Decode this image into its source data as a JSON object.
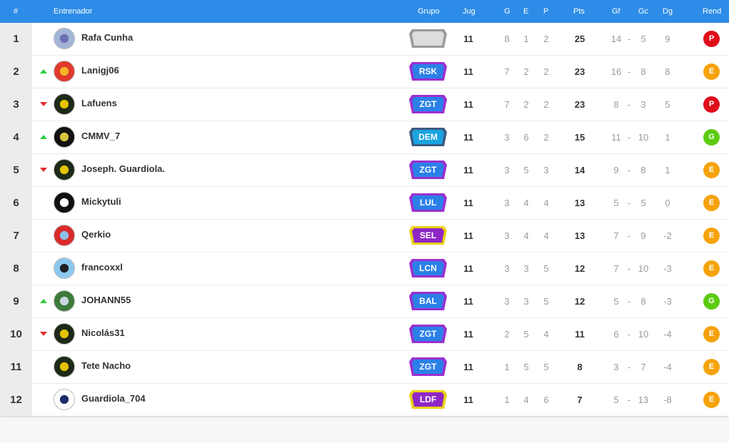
{
  "header": {
    "rank": "#",
    "coach": "Entrenador",
    "group": "Grupo",
    "played": "Jug",
    "won": "G",
    "drawn": "E",
    "lost": "P",
    "points": "Pts",
    "gf": "Gf",
    "gc": "Gc",
    "gd": "Dg",
    "form": "Rend"
  },
  "separator": "-",
  "colors": {
    "header_bg": "#2d8ce7",
    "trend_up": "#2ecc40",
    "trend_down": "#e32d2d",
    "form_P": "#e00d1a",
    "form_E": "#f6a20a",
    "form_G": "#5bcb10"
  },
  "rows": [
    {
      "rank": "1",
      "trend": "none",
      "coach": "Rafa Cunha",
      "group": "",
      "played": "11",
      "won": "8",
      "drawn": "1",
      "lost": "2",
      "points": "25",
      "gf": "14",
      "gc": "5",
      "gd": "9",
      "form": "P",
      "badge_color": "grey",
      "avatar_color": "#a3b5d6",
      "avatar_accent": "#6b6fb2"
    },
    {
      "rank": "2",
      "trend": "up",
      "coach": "Lanigj06",
      "group": "RSK",
      "played": "11",
      "won": "7",
      "drawn": "2",
      "lost": "2",
      "points": "23",
      "gf": "16",
      "gc": "8",
      "gd": "8",
      "form": "E",
      "badge_color": "blue",
      "avatar_color": "#e03a2c",
      "avatar_accent": "#f5b526"
    },
    {
      "rank": "3",
      "trend": "down",
      "coach": "Lafuens",
      "group": "ZGT",
      "played": "11",
      "won": "7",
      "drawn": "2",
      "lost": "2",
      "points": "23",
      "gf": "8",
      "gc": "3",
      "gd": "5",
      "form": "P",
      "badge_color": "blue",
      "avatar_color": "#1d2a17",
      "avatar_accent": "#e4c300"
    },
    {
      "rank": "4",
      "trend": "up",
      "coach": "CMMV_7",
      "group": "DEM",
      "played": "11",
      "won": "3",
      "drawn": "6",
      "lost": "2",
      "points": "15",
      "gf": "11",
      "gc": "10",
      "gd": "1",
      "form": "G",
      "badge_color": "cyan",
      "avatar_color": "#111111",
      "avatar_accent": "#d9c43f"
    },
    {
      "rank": "5",
      "trend": "down",
      "coach": "Joseph. Guardiola.",
      "group": "ZGT",
      "played": "11",
      "won": "3",
      "drawn": "5",
      "lost": "3",
      "points": "14",
      "gf": "9",
      "gc": "8",
      "gd": "1",
      "form": "E",
      "badge_color": "blue",
      "avatar_color": "#1d2a17",
      "avatar_accent": "#e4c300"
    },
    {
      "rank": "6",
      "trend": "none",
      "coach": "Mickytuli",
      "group": "LUL",
      "played": "11",
      "won": "3",
      "drawn": "4",
      "lost": "4",
      "points": "13",
      "gf": "5",
      "gc": "5",
      "gd": "0",
      "form": "E",
      "badge_color": "blue",
      "avatar_color": "#111111",
      "avatar_accent": "#ffffff"
    },
    {
      "rank": "7",
      "trend": "none",
      "coach": "Qerkio",
      "group": "SEL",
      "played": "11",
      "won": "3",
      "drawn": "4",
      "lost": "4",
      "points": "13",
      "gf": "7",
      "gc": "9",
      "gd": "-2",
      "form": "E",
      "badge_color": "purple",
      "avatar_color": "#d92b2b",
      "avatar_accent": "#8ec1e8"
    },
    {
      "rank": "8",
      "trend": "none",
      "coach": "francoxxl",
      "group": "LCN",
      "played": "11",
      "won": "3",
      "drawn": "3",
      "lost": "5",
      "points": "12",
      "gf": "7",
      "gc": "10",
      "gd": "-3",
      "form": "E",
      "badge_color": "blue",
      "avatar_color": "#8cc8ef",
      "avatar_accent": "#222222"
    },
    {
      "rank": "9",
      "trend": "up",
      "coach": "JOHANN55",
      "group": "BAL",
      "played": "11",
      "won": "3",
      "drawn": "3",
      "lost": "5",
      "points": "12",
      "gf": "5",
      "gc": "8",
      "gd": "-3",
      "form": "G",
      "badge_color": "blue",
      "avatar_color": "#3c7a3a",
      "avatar_accent": "#c9d6e0"
    },
    {
      "rank": "10",
      "trend": "down",
      "coach": "Nicolás31",
      "group": "ZGT",
      "played": "11",
      "won": "2",
      "drawn": "5",
      "lost": "4",
      "points": "11",
      "gf": "6",
      "gc": "10",
      "gd": "-4",
      "form": "E",
      "badge_color": "blue",
      "avatar_color": "#1d2a17",
      "avatar_accent": "#e4c300"
    },
    {
      "rank": "11",
      "trend": "none",
      "coach": "Tete Nacho",
      "group": "ZGT",
      "played": "11",
      "won": "1",
      "drawn": "5",
      "lost": "5",
      "points": "8",
      "gf": "3",
      "gc": "7",
      "gd": "-4",
      "form": "E",
      "badge_color": "blue",
      "avatar_color": "#1d2a17",
      "avatar_accent": "#e4c300"
    },
    {
      "rank": "12",
      "trend": "none",
      "coach": "Guardiola_704",
      "group": "LDF",
      "played": "11",
      "won": "1",
      "drawn": "4",
      "lost": "6",
      "points": "7",
      "gf": "5",
      "gc": "13",
      "gd": "-8",
      "form": "E",
      "badge_color": "purple",
      "avatar_color": "#ffffff",
      "avatar_accent": "#1b2d6b"
    }
  ]
}
